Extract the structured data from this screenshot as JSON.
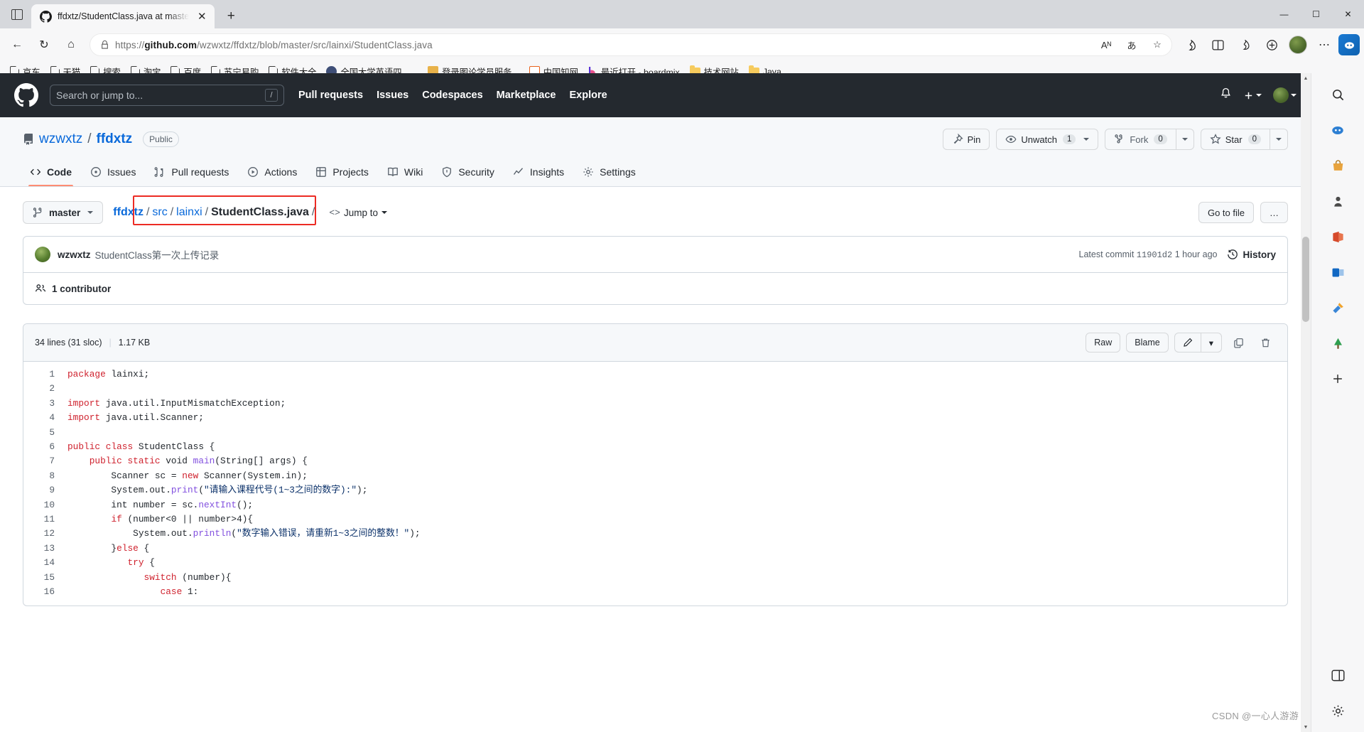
{
  "browser": {
    "tab": {
      "title": "ffdxtz/StudentClass.java at maste",
      "favicon": "github-icon",
      "close": "✕"
    },
    "newtab_label": "+",
    "window_controls": {
      "minimize": "—",
      "maximize": "☐",
      "close": "✕"
    },
    "nav": {
      "back": "←",
      "refresh": "↻",
      "home": "⌂"
    },
    "omnibox": {
      "lock_icon": "lock-icon",
      "url_prefix": "https://",
      "url_host": "github.com",
      "url_path": "/wzwxtz/ffdxtz/blob/master/src/lainxi/StudentClass.java",
      "read_aloud": "Aᴺ",
      "translate": "あ",
      "favorite": "☆",
      "collections": "collections-icon",
      "split_screen": "split-screen-icon",
      "browser_essentials": "browser-essentials-icon",
      "settings_more": "⋯"
    },
    "bookmarks": [
      {
        "label": "京东",
        "icon": "page-icon"
      },
      {
        "label": "天猫",
        "icon": "page-icon"
      },
      {
        "label": "搜索",
        "icon": "page-icon"
      },
      {
        "label": "淘宝",
        "icon": "page-icon"
      },
      {
        "label": "百度",
        "icon": "page-icon"
      },
      {
        "label": "苏宁易购",
        "icon": "page-icon"
      },
      {
        "label": "软件大全",
        "icon": "page-icon"
      },
      {
        "label": "全国大学英语四、...",
        "icon": "circle-icon"
      },
      {
        "label": "登录图论学员服务...",
        "icon": "square-icon"
      },
      {
        "label": "中国知网",
        "icon": "cnki-icon"
      },
      {
        "label": "最近打开 - boardmix",
        "icon": "boardmix-icon"
      },
      {
        "label": "技术网站",
        "icon": "folder-icon"
      },
      {
        "label": "Java",
        "icon": "folder-icon"
      }
    ]
  },
  "github": {
    "header": {
      "logo": "github-mark-icon",
      "search_placeholder": "Search or jump to...",
      "search_shortcut": "/",
      "nav": [
        "Pull requests",
        "Issues",
        "Codespaces",
        "Marketplace",
        "Explore"
      ],
      "notification_icon": "bell-icon",
      "create_new_icon": "plus-icon",
      "avatar": "user-avatar"
    },
    "repo": {
      "icon": "repo-icon",
      "owner": "wzwxtz",
      "separator": "/",
      "name": "ffdxtz",
      "visibility": "Public",
      "actions": {
        "pin": "Pin",
        "unwatch": "Unwatch",
        "unwatch_count": "1",
        "fork": "Fork",
        "fork_count": "0",
        "star": "Star",
        "star_count": "0"
      },
      "tabs": [
        {
          "label": "Code",
          "icon": "code-icon",
          "active": true
        },
        {
          "label": "Issues",
          "icon": "issue-opened-icon",
          "active": false
        },
        {
          "label": "Pull requests",
          "icon": "git-pull-request-icon",
          "active": false
        },
        {
          "label": "Actions",
          "icon": "play-icon",
          "active": false
        },
        {
          "label": "Projects",
          "icon": "table-icon",
          "active": false
        },
        {
          "label": "Wiki",
          "icon": "book-icon",
          "active": false
        },
        {
          "label": "Security",
          "icon": "shield-icon",
          "active": false
        },
        {
          "label": "Insights",
          "icon": "graph-icon",
          "active": false
        },
        {
          "label": "Settings",
          "icon": "gear-icon",
          "active": false
        }
      ]
    },
    "file_toolbar": {
      "branch": "master",
      "branch_icon": "git-branch-icon",
      "breadcrumb": {
        "repo": "ffdxtz",
        "sep1": "/",
        "dir1": "src",
        "sep2": "/",
        "dir2": "lainxi",
        "sep3": "/",
        "file": "StudentClass.java",
        "sep4": "/"
      },
      "jump_to": "Jump to",
      "jump_icon": "<>",
      "go_to_file": "Go to file",
      "more": "…"
    },
    "commit": {
      "author": "wzwxtz",
      "message": "StudentClass第一次上传记录",
      "latest_commit_label": "Latest commit",
      "sha": "11901d2",
      "time": "1 hour ago",
      "history": "History",
      "history_icon": "history-icon",
      "contributors": "1 contributor",
      "contributors_icon": "people-icon"
    },
    "file": {
      "lines_info": "34 lines (31 sloc)",
      "size": "1.17 KB",
      "raw": "Raw",
      "blame": "Blame",
      "edit_icon": "pencil-icon",
      "edit_caret": "▾",
      "copy_icon": "copy-icon",
      "delete_icon": "trash-icon"
    },
    "code": {
      "lines": [
        {
          "n": "1",
          "html": "<span class=\"k\">package</span> lainxi;"
        },
        {
          "n": "2",
          "html": ""
        },
        {
          "n": "3",
          "html": "<span class=\"k\">import</span> java.util.InputMismatchException;"
        },
        {
          "n": "4",
          "html": "<span class=\"k\">import</span> java.util.Scanner;"
        },
        {
          "n": "5",
          "html": ""
        },
        {
          "n": "6",
          "html": "<span class=\"k\">public</span> <span class=\"k\">class</span> StudentClass {"
        },
        {
          "n": "7",
          "html": "    <span class=\"k\">public</span> <span class=\"k\">static</span> void <span class=\"fn\">main</span>(String[] args) {"
        },
        {
          "n": "8",
          "html": "        Scanner sc = <span class=\"k\">new</span> Scanner(System.in);"
        },
        {
          "n": "9",
          "html": "        System.out.<span class=\"fn\">print</span>(<span class=\"st\">\"请输入课程代号(1~3之间的数字):\"</span>);"
        },
        {
          "n": "10",
          "html": "        int number = sc.<span class=\"fn\">nextInt</span>();"
        },
        {
          "n": "11",
          "html": "        <span class=\"k\">if</span> (number&lt;0 || number&gt;4){"
        },
        {
          "n": "12",
          "html": "            System.out.<span class=\"fn\">println</span>(<span class=\"st\">\"数字输入错误，请重新1~3之间的整数！\"</span>);"
        },
        {
          "n": "13",
          "html": "        }<span class=\"k\">else</span> {"
        },
        {
          "n": "14",
          "html": "           <span class=\"k\">try</span> {"
        },
        {
          "n": "15",
          "html": "              <span class=\"k\">switch</span> (number){"
        },
        {
          "n": "16",
          "html": "                 <span class=\"k\">case</span> 1:"
        }
      ]
    }
  },
  "edge_sidebar": {
    "top": [
      "search-icon",
      "copilot-icon",
      "shopping-icon",
      "games-icon",
      "office-icon",
      "outlook-icon",
      "tools-icon",
      "tree-icon",
      "add-icon"
    ],
    "bottom": [
      "split-icon",
      "settings-icon"
    ]
  },
  "watermark": "CSDN @一心人游游"
}
